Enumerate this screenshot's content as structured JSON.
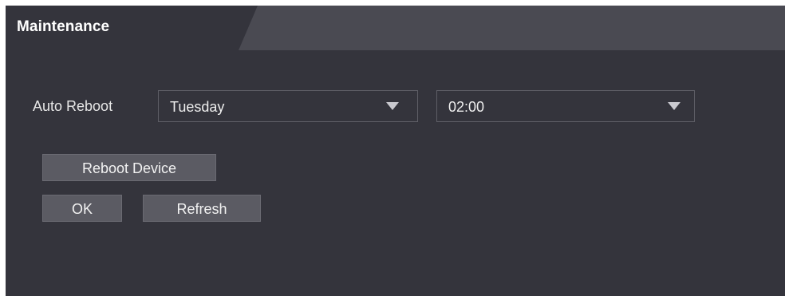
{
  "tab": {
    "title": "Maintenance"
  },
  "auto_reboot": {
    "label": "Auto Reboot",
    "day_value": "Tuesday",
    "time_value": "02:00"
  },
  "buttons": {
    "reboot_device": "Reboot Device",
    "ok": "OK",
    "refresh": "Refresh"
  },
  "colors": {
    "panel_bg": "#34343c",
    "tabbar_bg": "#4a4a52",
    "active_tab_bg": "#34343c",
    "button_bg": "#5b5b63",
    "text": "#ffffff"
  },
  "icons": {
    "dropdown": "chevron-down-icon"
  }
}
